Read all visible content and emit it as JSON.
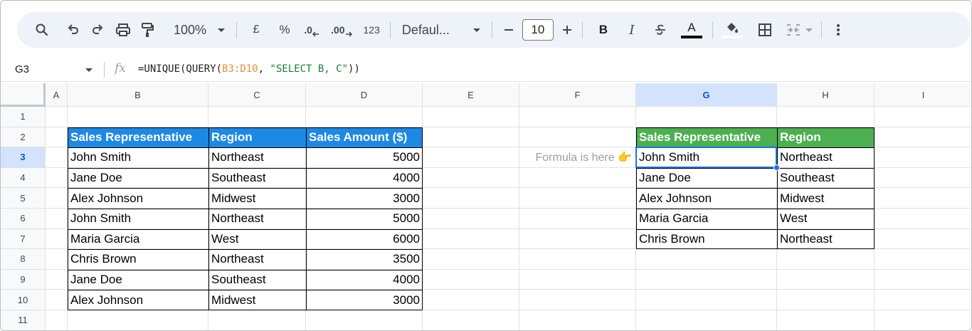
{
  "toolbar": {
    "zoom": "100%",
    "currency": "£",
    "percent": "%",
    "decrease_decimal": ".0",
    "increase_decimal": ".00",
    "number_format": "123",
    "font": "Defaul...",
    "font_size": "10",
    "bold": "B",
    "italic": "I",
    "text_color_letter": "A"
  },
  "formula_bar": {
    "cell_ref": "G3",
    "fx": "fx",
    "formula_prefix": "=UNIQUE(QUERY(",
    "formula_range": "B3:D10",
    "formula_sep": ", ",
    "formula_string": "\"SELECT B, C\"",
    "formula_suffix": "))"
  },
  "columns": [
    "A",
    "B",
    "C",
    "D",
    "E",
    "F",
    "G",
    "H",
    "I"
  ],
  "rows": [
    "1",
    "2",
    "3",
    "4",
    "5",
    "6",
    "7",
    "8",
    "9",
    "10",
    "11"
  ],
  "selected": {
    "column": "G",
    "row": "3"
  },
  "source_table": {
    "headers": [
      "Sales Representative",
      "Region",
      "Sales Amount ($)"
    ],
    "rows": [
      [
        "John Smith",
        "Northeast",
        "5000"
      ],
      [
        "Jane Doe",
        "Southeast",
        "4000"
      ],
      [
        "Alex Johnson",
        "Midwest",
        "3000"
      ],
      [
        "John Smith",
        "Northeast",
        "5000"
      ],
      [
        "Maria Garcia",
        "West",
        "6000"
      ],
      [
        "Chris Brown",
        "Northeast",
        "3500"
      ],
      [
        "Jane Doe",
        "Southeast",
        "4000"
      ],
      [
        "Alex Johnson",
        "Midwest",
        "3000"
      ]
    ],
    "header_color": "#1e88e5"
  },
  "note": "Formula is here 👉",
  "result_table": {
    "headers": [
      "Sales Representative",
      "Region"
    ],
    "rows": [
      [
        "John Smith",
        "Northeast"
      ],
      [
        "Jane Doe",
        "Southeast"
      ],
      [
        "Alex Johnson",
        "Midwest"
      ],
      [
        "Maria Garcia",
        "West"
      ],
      [
        "Chris Brown",
        "Northeast"
      ]
    ],
    "header_color": "#4caf50"
  }
}
